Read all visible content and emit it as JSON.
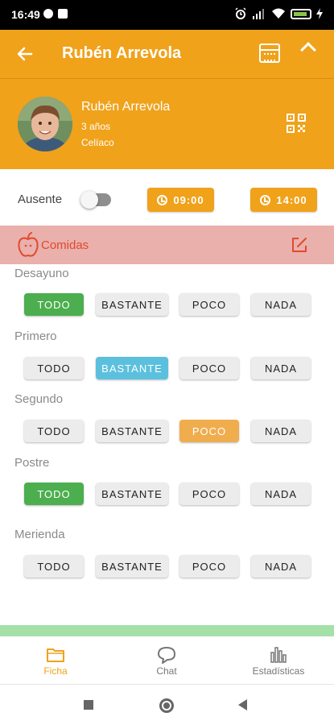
{
  "status_bar": {
    "time": "16:49",
    "icons": [
      "alarm-icon",
      "signal-icon",
      "wifi-icon",
      "battery-icon",
      "charging-icon"
    ]
  },
  "app_bar": {
    "back_icon": "arrow-left-icon",
    "title": "Rubén Arrevola",
    "calendar_icon": "calendar-icon",
    "collapse_icon": "chevron-up-icon"
  },
  "profile": {
    "name": "Rubén Arrevola",
    "age": "3 años",
    "diet": "Celíaco",
    "qr_icon": "qr-code-icon"
  },
  "absence": {
    "label": "Ausente",
    "absent": false,
    "times": [
      "09:00",
      "14:00"
    ]
  },
  "meals_section": {
    "title": "Comidas",
    "icon": "apple-icon",
    "edit_icon": "edit-icon"
  },
  "options": [
    "TODO",
    "BASTANTE",
    "POCO",
    "NADA"
  ],
  "meals": [
    {
      "label": "Desayuno",
      "selected": "TODO"
    },
    {
      "label": "Primero",
      "selected": "BASTANTE"
    },
    {
      "label": "Segundo",
      "selected": "POCO"
    },
    {
      "label": "Postre",
      "selected": "TODO"
    },
    {
      "label": "Merienda",
      "selected": ""
    }
  ],
  "colors": {
    "primary": "#f0a21b",
    "section_bg": "#e9b0ac",
    "section_text": "#e2492d",
    "todo_selected": "#4cae4f",
    "bastante_selected": "#5bc0de",
    "poco_selected": "#f0ad4e",
    "strip": "#a5e0a8"
  },
  "bottom_nav": [
    {
      "label": "Ficha",
      "icon": "folder-icon",
      "active": true
    },
    {
      "label": "Chat",
      "icon": "chat-bubble-icon",
      "active": false
    },
    {
      "label": "Estadísticas",
      "icon": "bar-chart-icon",
      "active": false
    }
  ],
  "system_nav": [
    "square-icon",
    "home-circle-icon",
    "back-triangle-icon"
  ]
}
